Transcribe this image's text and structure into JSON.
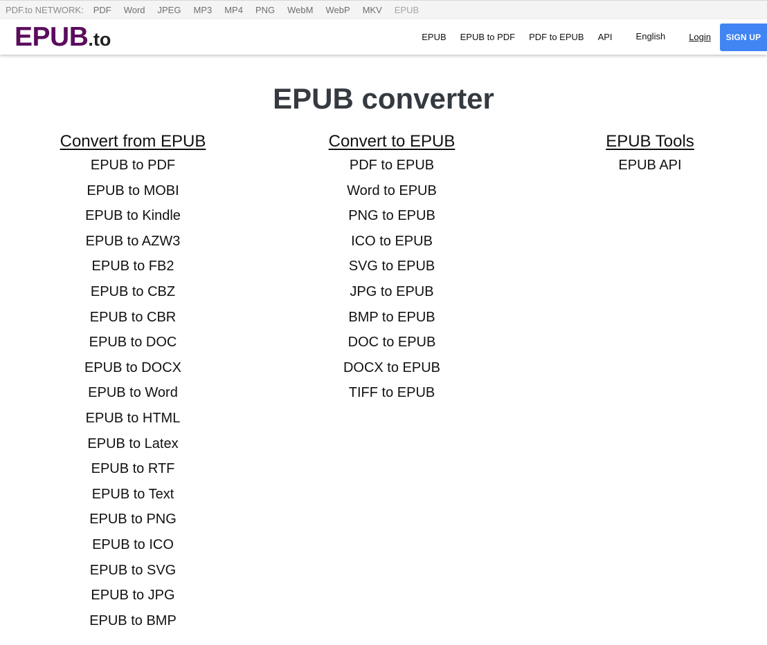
{
  "network": {
    "label": "PDF.to NETWORK:",
    "links": [
      "PDF",
      "Word",
      "JPEG",
      "MP3",
      "MP4",
      "PNG",
      "WebM",
      "WebP",
      "MKV"
    ],
    "current": "EPUB"
  },
  "header": {
    "logo_main": "EPUB",
    "logo_suffix": ".to",
    "nav": [
      "EPUB",
      "EPUB to PDF",
      "PDF to EPUB",
      "API"
    ],
    "language": "English",
    "login": "Login",
    "signup": "SIGN UP"
  },
  "colors": {
    "logo": "#5b0c5d",
    "signup_bg": "#4184f3",
    "title": "#343a40"
  },
  "main": {
    "title": "EPUB converter",
    "columns": [
      {
        "heading": "Convert from EPUB",
        "items": [
          "EPUB to PDF",
          "EPUB to MOBI",
          "EPUB to Kindle",
          "EPUB to AZW3",
          "EPUB to FB2",
          "EPUB to CBZ",
          "EPUB to CBR",
          "EPUB to DOC",
          "EPUB to DOCX",
          "EPUB to Word",
          "EPUB to HTML",
          "EPUB to Latex",
          "EPUB to RTF",
          "EPUB to Text",
          "EPUB to PNG",
          "EPUB to ICO",
          "EPUB to SVG",
          "EPUB to JPG",
          "EPUB to BMP"
        ]
      },
      {
        "heading": "Convert to EPUB",
        "items": [
          "PDF to EPUB",
          "Word to EPUB",
          "PNG to EPUB",
          "ICO to EPUB",
          "SVG to EPUB",
          "JPG to EPUB",
          "BMP to EPUB",
          "DOC to EPUB",
          "DOCX to EPUB",
          "TIFF to EPUB"
        ]
      },
      {
        "heading": "EPUB Tools",
        "items": [
          "EPUB API"
        ]
      }
    ]
  }
}
